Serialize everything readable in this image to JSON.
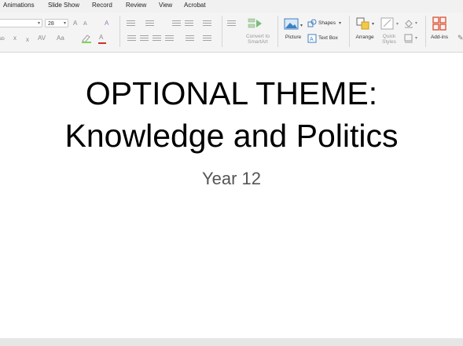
{
  "menu": [
    "Animations",
    "Slide Show",
    "Record",
    "Review",
    "View",
    "Acrobat"
  ],
  "font": {
    "size": "28"
  },
  "ribbon": {
    "convert_smartart": [
      "Convert to",
      "SmartArt"
    ],
    "picture": "Picture",
    "shapes": "Shapes",
    "text_box": "Text Box",
    "arrange": "Arrange",
    "quick_styles": [
      "Quick",
      "Styles"
    ],
    "add_ins": "Add-ins",
    "font_glyphs": {
      "grow": "A",
      "shrink": "A",
      "clear": "A",
      "super": "x",
      "sub": "x",
      "spacing": "AV",
      "case": "Aa",
      "color": "A",
      "highlight": "ab"
    }
  },
  "slide": {
    "title_line1": "OPTIONAL THEME:",
    "title_line2": "Knowledge and Politics",
    "subtitle": "Year 12"
  },
  "colors": {
    "accent_addins": "#e0583a",
    "picture_blue": "#3f7fc2",
    "font_color_red": "#d0312d",
    "smartart_green": "#4aa34a"
  }
}
